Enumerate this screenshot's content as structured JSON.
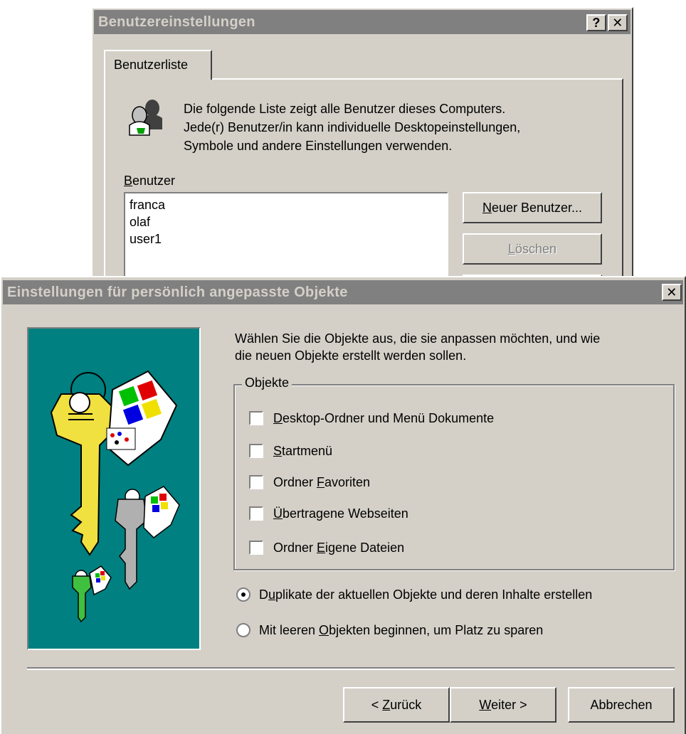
{
  "back_dialog": {
    "title": "Benutzereinstellungen",
    "help_button": "?",
    "close_button": "✕",
    "tab_label": "Benutzerliste",
    "intro_line1": "Die folgende Liste zeigt alle Benutzer dieses Computers.",
    "intro_line2": "Jede(r) Benutzer/in kann individuelle Desktopeinstellungen,",
    "intro_line3": "Symbole und andere Einstellungen verwenden.",
    "users_label_accel": "B",
    "users_label_rest": "enutzer",
    "users": [
      "franca",
      "olaf",
      "user1"
    ],
    "new_user_accel": "N",
    "new_user_rest": "euer Benutzer...",
    "delete_accel": "L",
    "delete_rest": "öschen"
  },
  "front_dialog": {
    "title": "Einstellungen für persönlich angepasste Objekte",
    "close_button": "✕",
    "intro_line1": "Wählen Sie die Objekte aus, die sie anpassen möchten, und wie",
    "intro_line2": "die neuen Objekte erstellt werden sollen.",
    "group_label": "Objekte",
    "options": [
      {
        "pre": "",
        "accel": "D",
        "post": "esktop-Ordner und Menü Dokumente",
        "checked": false
      },
      {
        "pre": "",
        "accel": "S",
        "post": "tartmenü",
        "checked": false
      },
      {
        "pre": "Ordner ",
        "accel": "F",
        "post": "avoriten",
        "checked": false
      },
      {
        "pre": "",
        "accel": "Ü",
        "post": "bertragene Webseiten",
        "checked": false
      },
      {
        "pre": "Ordner ",
        "accel": "E",
        "post": "igene Dateien",
        "checked": false
      }
    ],
    "radio1": {
      "pre": "D",
      "accel": "u",
      "post": "plikate der aktuellen Objekte und deren Inhalte erstellen",
      "checked": true
    },
    "radio2": {
      "pre": "Mit leeren ",
      "accel": "O",
      "post": "bjekten beginnen, um Platz zu sparen",
      "checked": false
    },
    "back_button": {
      "pre": "< ",
      "accel": "Z",
      "post": "urück"
    },
    "next_button": {
      "pre": "",
      "accel": "W",
      "post": "eiter >"
    },
    "cancel_button": "Abbrechen"
  },
  "colors": {
    "dialog_face": "#d4d0c8",
    "inactive_titlebar": "#808080",
    "art_background": "#008080"
  }
}
